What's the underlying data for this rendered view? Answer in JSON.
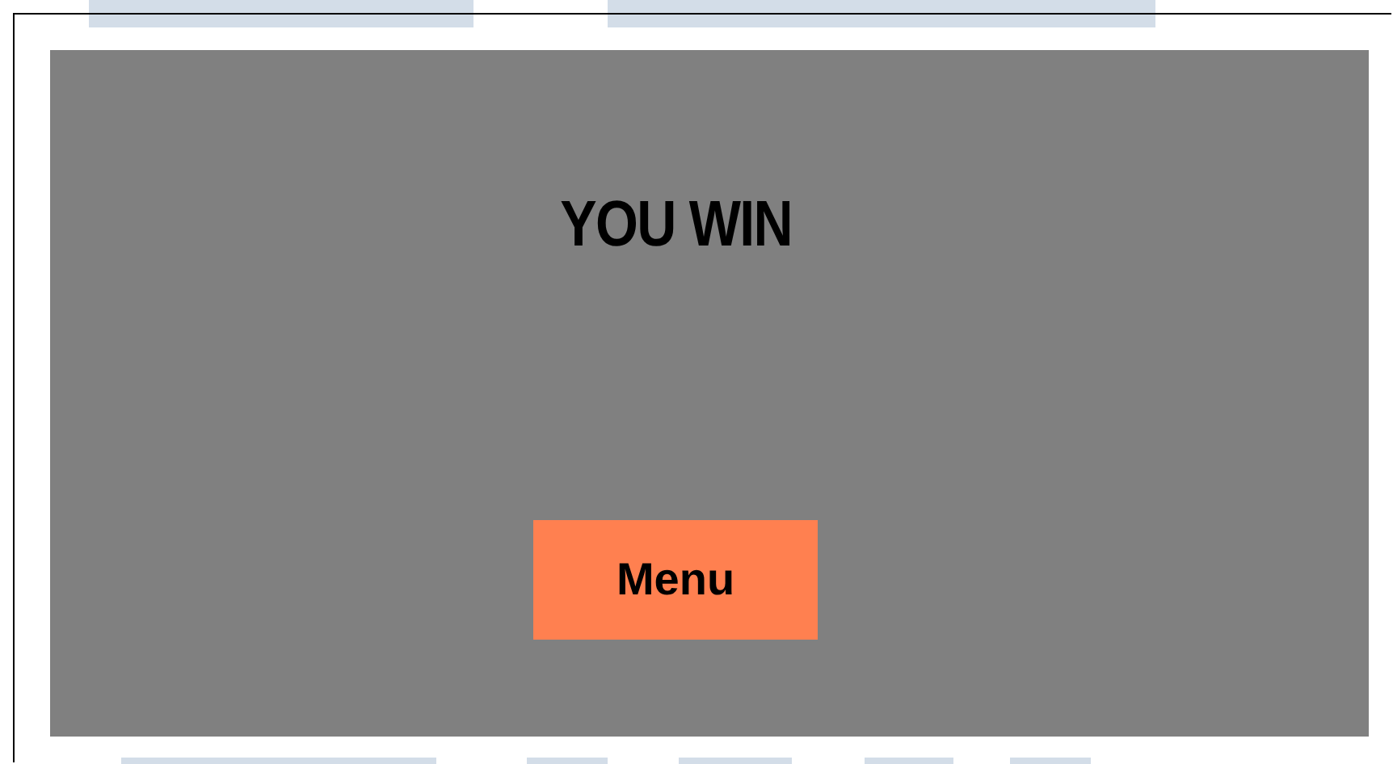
{
  "title": "YOU WIN",
  "menu_button": {
    "label": "Menu"
  }
}
